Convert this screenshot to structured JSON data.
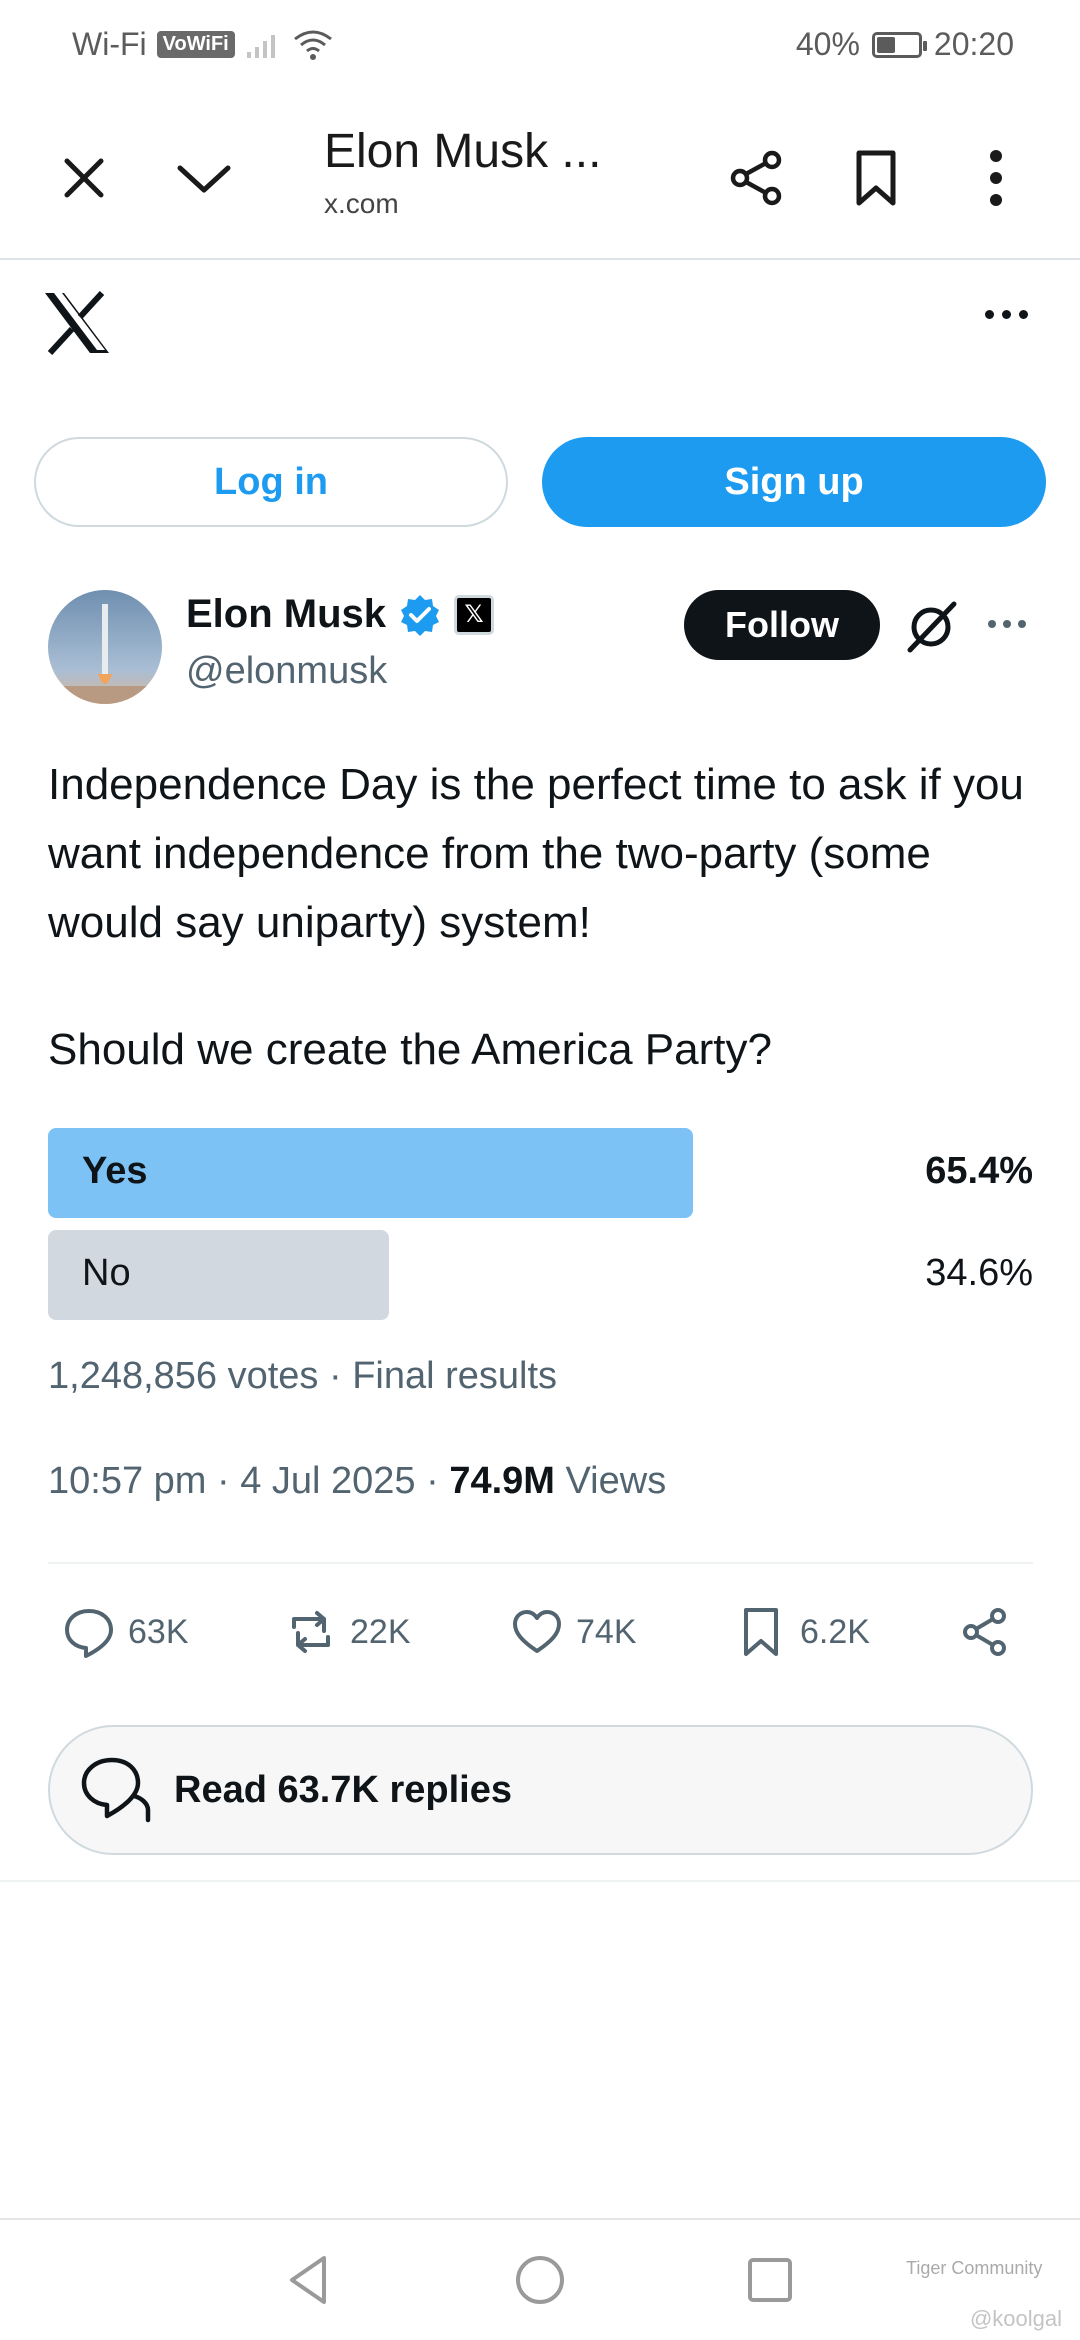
{
  "status_bar": {
    "wifi_label": "Wi-Fi",
    "vowifi_label": "VoWiFi",
    "battery": "40%",
    "time": "20:20"
  },
  "browser": {
    "title": "Elon Musk ...",
    "url": "x.com",
    "icons": [
      "close-icon",
      "chevron-down-icon",
      "share-icon",
      "bookmark-icon",
      "more-vertical-icon"
    ]
  },
  "auth": {
    "login_label": "Log in",
    "signup_label": "Sign up"
  },
  "tweet": {
    "author_name": "Elon Musk",
    "handle": "@elonmusk",
    "follow_label": "Follow",
    "text": "Independence Day is the perfect time to ask if you want independence from the two-party (some would say uniparty) system!",
    "question": "Should we create the America Party?",
    "poll": {
      "options": [
        {
          "label": "Yes",
          "percent": "65.4%",
          "fraction": 0.654,
          "winner": true
        },
        {
          "label": "No",
          "percent": "34.6%",
          "fraction": 0.346,
          "winner": false
        }
      ],
      "meta": "1,248,856 votes · Final results"
    },
    "timestamp": "10:57 pm · 4 Jul 2025 · ",
    "views_count": "74.9M",
    "views_label": " Views",
    "stats": {
      "replies": "63K",
      "reposts": "22K",
      "likes": "74K",
      "bookmarks": "6.2K"
    },
    "read_replies_label": "Read 63.7K replies"
  },
  "watermark": {
    "brand": "Tiger Community",
    "user": "@koolgal"
  },
  "colors": {
    "accent": "#1d9bf0",
    "poll_winner": "#7cc2f5",
    "poll_other": "#d2d8df",
    "text_secondary": "#536471"
  }
}
